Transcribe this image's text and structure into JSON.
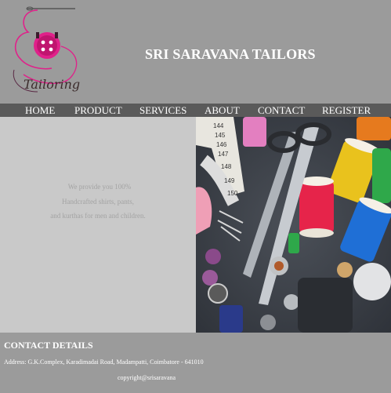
{
  "header": {
    "logo_text": "Tailoring",
    "site_title": "SRI SARAVANA TAILORS"
  },
  "nav": {
    "items": [
      {
        "label": "HOME"
      },
      {
        "label": "PRODUCT"
      },
      {
        "label": "SERVICES"
      },
      {
        "label": "ABOUT"
      },
      {
        "label": "CONTACT"
      },
      {
        "label": "REGISTER"
      }
    ]
  },
  "intro": {
    "lines": [
      "We provide you 100%",
      "Handcrafted shirts, pants,",
      "and kurthas for men and children."
    ]
  },
  "hero_image": {
    "icon": "sewing-supplies-photo",
    "tape_numbers": [
      "144",
      "145",
      "146",
      "147",
      "148",
      "149",
      "150"
    ]
  },
  "footer": {
    "heading": "CONTACT DETAILS",
    "address": "Address: G.K.Complex, Karadimadai Road, Madampatti, Coimbatore - 641010",
    "copyright": "copyright@srisaravana"
  },
  "colors": {
    "background": "#9b9b9b",
    "nav_background": "#5a5a5a",
    "panel_background": "#c9c9c9",
    "logo_accent": "#e0218a"
  }
}
